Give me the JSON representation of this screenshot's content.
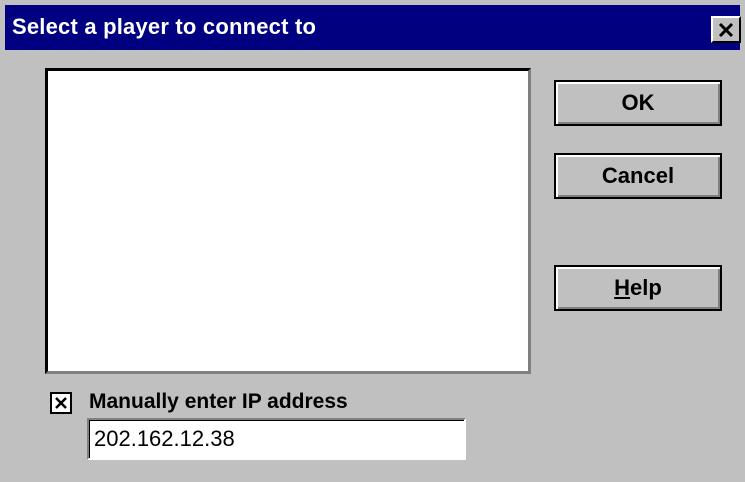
{
  "dialog": {
    "title": "Select a player to connect to",
    "close_symbol": "×"
  },
  "player_list": {
    "items": []
  },
  "buttons": {
    "ok": "OK",
    "cancel": "Cancel",
    "help_hotkey": "H",
    "help_rest": "elp"
  },
  "manual_ip": {
    "checked": true,
    "label": "Manually enter IP address",
    "value": "202.162.12.38"
  },
  "colors": {
    "titlebar": "#000080",
    "face": "#c0c0c0",
    "field": "#ffffff"
  }
}
